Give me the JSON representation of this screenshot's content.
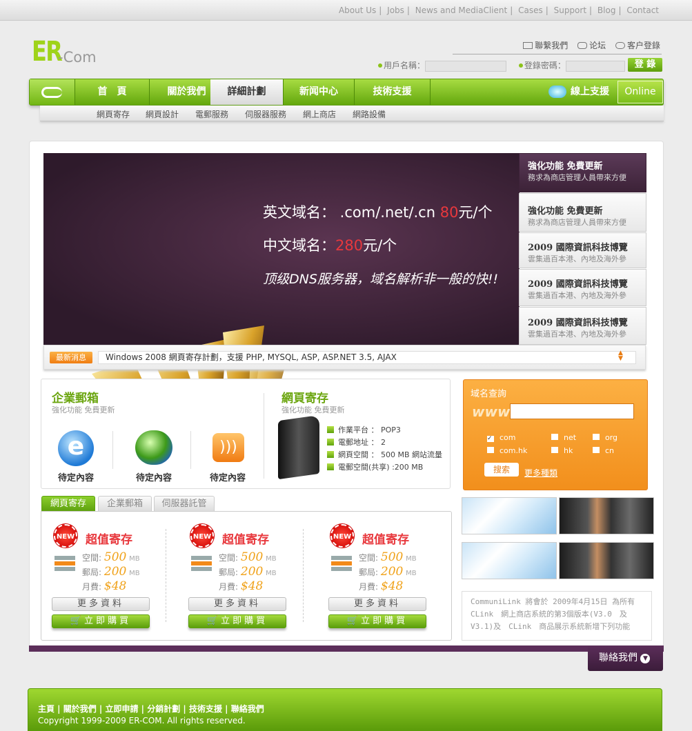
{
  "toplinks": [
    "About Us",
    "Jobs",
    "News and MediaClient",
    "Cases",
    "Support",
    "Blog",
    "Contact"
  ],
  "logo": {
    "main": "ER",
    "sub": "-Com"
  },
  "util": {
    "contact": "聯繫我們",
    "forum": "论坛",
    "login": "客户登錄"
  },
  "login": {
    "user_label": "用戶名稱：",
    "pass_label": "登錄密碼：",
    "button": "登 錄"
  },
  "nav": [
    "首　頁",
    "關於我們",
    "詳細計劃",
    "新闻中心",
    "技術支援"
  ],
  "support": "線上支援",
  "online": "Online",
  "subnav": [
    "網頁寄存",
    "網頁設計",
    "電郵服務",
    "伺服器服務",
    "網上商店",
    "網路設備"
  ],
  "banner": {
    "line1a": "英文域名： .com/.net/.cn ",
    "line1b": "80",
    "line1c": "元/个",
    "line2a": "中文域名：",
    "line2b": "280",
    "line2c": "元/个",
    "line3": "顶级DNS服务器，域名解析非一般的快!!"
  },
  "side": [
    {
      "t": "強化功能 免費更新",
      "s": "務求為商店管理人員帶來方便"
    },
    {
      "t": "強化功能 免費更新",
      "s": "務求為商店管理人員帶來方便"
    },
    {
      "t": "2009 國際資訊科技博覽",
      "s": "雲集過百本港、內地及海外參"
    },
    {
      "t": "2009 國際資訊科技博覽",
      "s": "雲集過百本港、內地及海外參"
    },
    {
      "t": "2009 國際資訊科技博覽",
      "s": "雲集過百本港、內地及海外參"
    }
  ],
  "news": {
    "badge": "最新消息",
    "text": "Windows 2008 網頁寄存計劃，支援 PHP, MYSQL, ASP, ASP.NET 3.5, AJAX"
  },
  "mail": {
    "title": "企業郵箱",
    "sub": "強化功能 免費更新",
    "items": [
      "待定內容",
      "待定內容",
      "待定內容"
    ]
  },
  "hosting": {
    "title": "網頁寄存",
    "sub": "強化功能 免費更新",
    "specs": [
      "作業平台 ： POP3",
      "電郵地址 ： 2",
      "網頁空間 ： 500 MB 網站流量",
      "電郵空間(共享) :200 MB"
    ]
  },
  "domain": {
    "title": "域名查詢",
    "www": "www.",
    "opts": [
      "com",
      "net",
      "org",
      "com.hk",
      "hk",
      "cn"
    ],
    "search": "搜索",
    "more": "更多種類"
  },
  "tabs": [
    "網頁寄存",
    "企業郵箱",
    "伺服器託管"
  ],
  "plans": [
    {
      "badge": "NEW",
      "title": "超值寄存",
      "space_l": "空間:",
      "space": "500",
      "mail_l": "郵局:",
      "mail": "200",
      "unit": "MB",
      "fee_l": "月費:",
      "fee": "$48",
      "more": "更多資料",
      "buy": "立即購買"
    },
    {
      "badge": "NEW",
      "title": "超值寄存",
      "space_l": "空間:",
      "space": "500",
      "mail_l": "郵局:",
      "mail": "200",
      "unit": "MB",
      "fee_l": "月費:",
      "fee": "$48",
      "more": "更多資料",
      "buy": "立即購買"
    },
    {
      "badge": "NEW",
      "title": "超值寄存",
      "space_l": "空間:",
      "space": "500",
      "mail_l": "郵局:",
      "mail": "200",
      "unit": "MB",
      "fee_l": "月費:",
      "fee": "$48",
      "more": "更多資料",
      "buy": "立即購買"
    }
  ],
  "textbox": "CommuniLink 將會於 2009年4月15日 為所有 CLink　網上商店系統的第3個版本(V3.0　及 V3.1)及　CLink　商品展示系統新增下列功能",
  "contact": "聯絡我們",
  "footer": {
    "links": "主頁 | 關於我們 | 立即申請 | 分銷計劃 | 技術支援 | 聯絡我們",
    "copy": "Copyright 1999-2009 ER-COM. All rights reserved."
  },
  "colors": {
    "green": "#7cbf1a",
    "purple": "#5c2e5a",
    "orange": "#f7a12e",
    "red": "#e8383d"
  }
}
